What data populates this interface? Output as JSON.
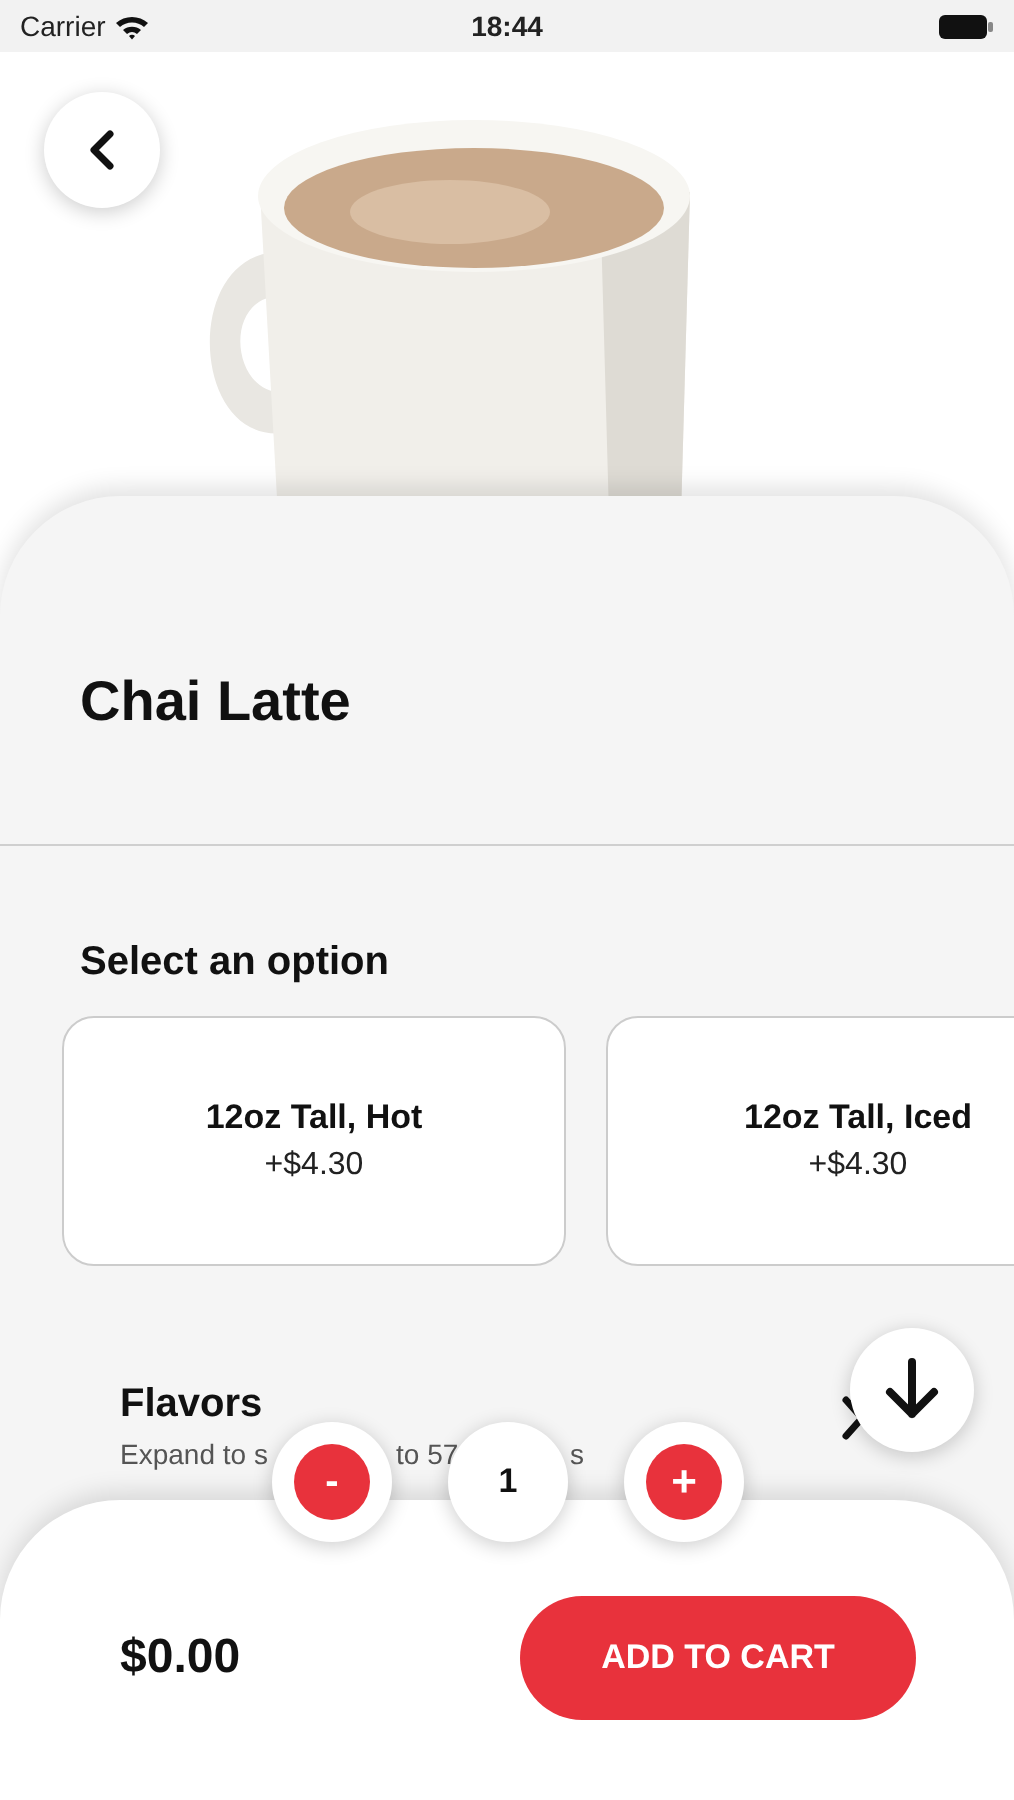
{
  "status_bar": {
    "carrier": "Carrier",
    "time": "18:44"
  },
  "product": {
    "title": "Chai Latte"
  },
  "options_section": {
    "title": "Select an option",
    "options": [
      {
        "name": "12oz Tall, Hot",
        "price": "+$4.30",
        "selected": false
      },
      {
        "name": "12oz Tall, Iced",
        "price": "+$4.30",
        "selected": false
      }
    ]
  },
  "flavors": {
    "title": "Flavors",
    "subtitle_fragments": [
      "Expand to s",
      "to 57",
      "s"
    ],
    "expanded": false
  },
  "quantity": {
    "minus": "-",
    "value": "1",
    "plus": "+"
  },
  "footer": {
    "total": "$0.00",
    "button": "ADD TO CART"
  }
}
